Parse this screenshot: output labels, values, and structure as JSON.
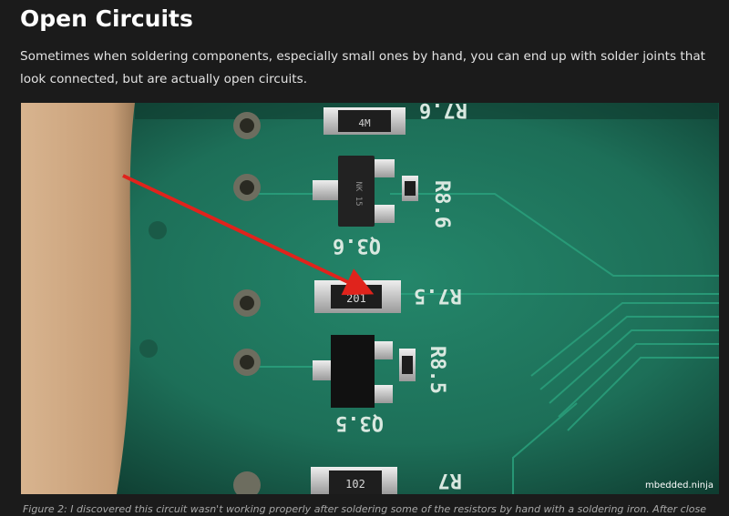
{
  "article": {
    "heading": "Open Circuits",
    "intro": "Sometimes when soldering components, especially small ones by hand, you can end up with solder joints that look connected, but are actually open circuits."
  },
  "figure": {
    "silkscreen": {
      "r_top": "R7.6",
      "r8_6": "R8.6",
      "q3_6": "Q3.6",
      "r7_5": "R7.5",
      "r8_5": "R8.5",
      "q3_5": "Q3.5",
      "r_bottom": "R7"
    },
    "components": {
      "resistor_top": "4M",
      "transistor_upper": "NK 15",
      "resistor_mid": "201",
      "resistor_bottom": "102"
    },
    "watermark": "mbedded.ninja",
    "colors": {
      "board": "#1f6f57",
      "arrow": "#e0231c",
      "pad": "#c9c9c9"
    }
  },
  "caption": "Figure 2: I discovered this circuit wasn't working properly after soldering some of the resistors by hand with a soldering iron. After close"
}
